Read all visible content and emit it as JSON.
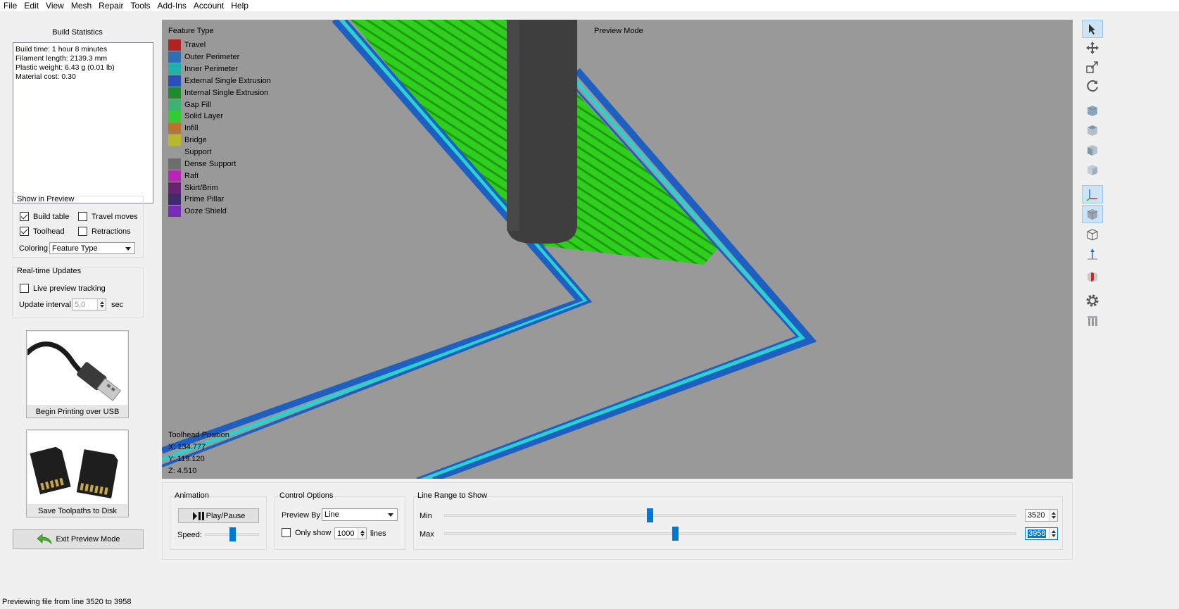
{
  "menu": [
    "File",
    "Edit",
    "View",
    "Mesh",
    "Repair",
    "Tools",
    "Add-Ins",
    "Account",
    "Help"
  ],
  "build_stats": {
    "title": "Build Statistics",
    "lines": [
      "Build time: 1 hour 8 minutes",
      "Filament length: 2139.3 mm",
      "Plastic weight: 6.43 g (0.01 lb)",
      "Material cost: 0.30"
    ]
  },
  "show_in_preview": {
    "title": "Show in Preview",
    "build_table": "Build table",
    "travel_moves": "Travel moves",
    "toolhead": "Toolhead",
    "retractions": "Retractions",
    "coloring_label": "Coloring",
    "coloring_value": "Feature Type"
  },
  "realtime": {
    "title": "Real-time Updates",
    "live_tracking": "Live preview tracking",
    "interval_label": "Update interval",
    "interval_value": "5,0",
    "interval_unit": "sec"
  },
  "usb_button": "Begin Printing over USB",
  "disk_button": "Save Toolpaths to Disk",
  "exit_button": "Exit Preview Mode",
  "legend": {
    "title": "Feature Type",
    "items": [
      {
        "label": "Travel",
        "color": "#b22222"
      },
      {
        "label": "Outer Perimeter",
        "color": "#2e6eb5"
      },
      {
        "label": "Inner Perimeter",
        "color": "#20b2aa"
      },
      {
        "label": "External Single Extrusion",
        "color": "#2b4fb8"
      },
      {
        "label": "Internal Single Extrusion",
        "color": "#1e8c2b"
      },
      {
        "label": "Gap Fill",
        "color": "#3cb371"
      },
      {
        "label": "Solid Layer",
        "color": "#32cd32"
      },
      {
        "label": "Infill",
        "color": "#b8732e"
      },
      {
        "label": "Bridge",
        "color": "#b8b828"
      },
      {
        "label": "Support",
        "color": "#999999"
      },
      {
        "label": "Dense Support",
        "color": "#6e6e6e"
      },
      {
        "label": "Raft",
        "color": "#b826b8"
      },
      {
        "label": "Skirt/Brim",
        "color": "#6a2370"
      },
      {
        "label": "Prime Pillar",
        "color": "#3e2b6e"
      },
      {
        "label": "Ooze Shield",
        "color": "#7b2ab8"
      }
    ]
  },
  "preview_mode": "Preview Mode",
  "toolhead_position": {
    "title": "Toolhead Position",
    "x": "X: 134.777",
    "y": "Y: 119.120",
    "z": "Z: 4.510"
  },
  "animation": {
    "title": "Animation",
    "play_pause": "Play/Pause",
    "speed_label": "Speed:",
    "speed_level": 0.5
  },
  "control_options": {
    "title": "Control Options",
    "preview_by_label": "Preview By",
    "preview_by_value": "Line",
    "only_show_label": "Only show",
    "only_show_value": "1000",
    "only_show_unit": "lines"
  },
  "line_range": {
    "title": "Line Range to Show",
    "min_label": "Min",
    "min_value": "3520",
    "max_label": "Max",
    "max_value": "3958"
  },
  "status_bar": "Previewing file from line 3520 to 3958"
}
